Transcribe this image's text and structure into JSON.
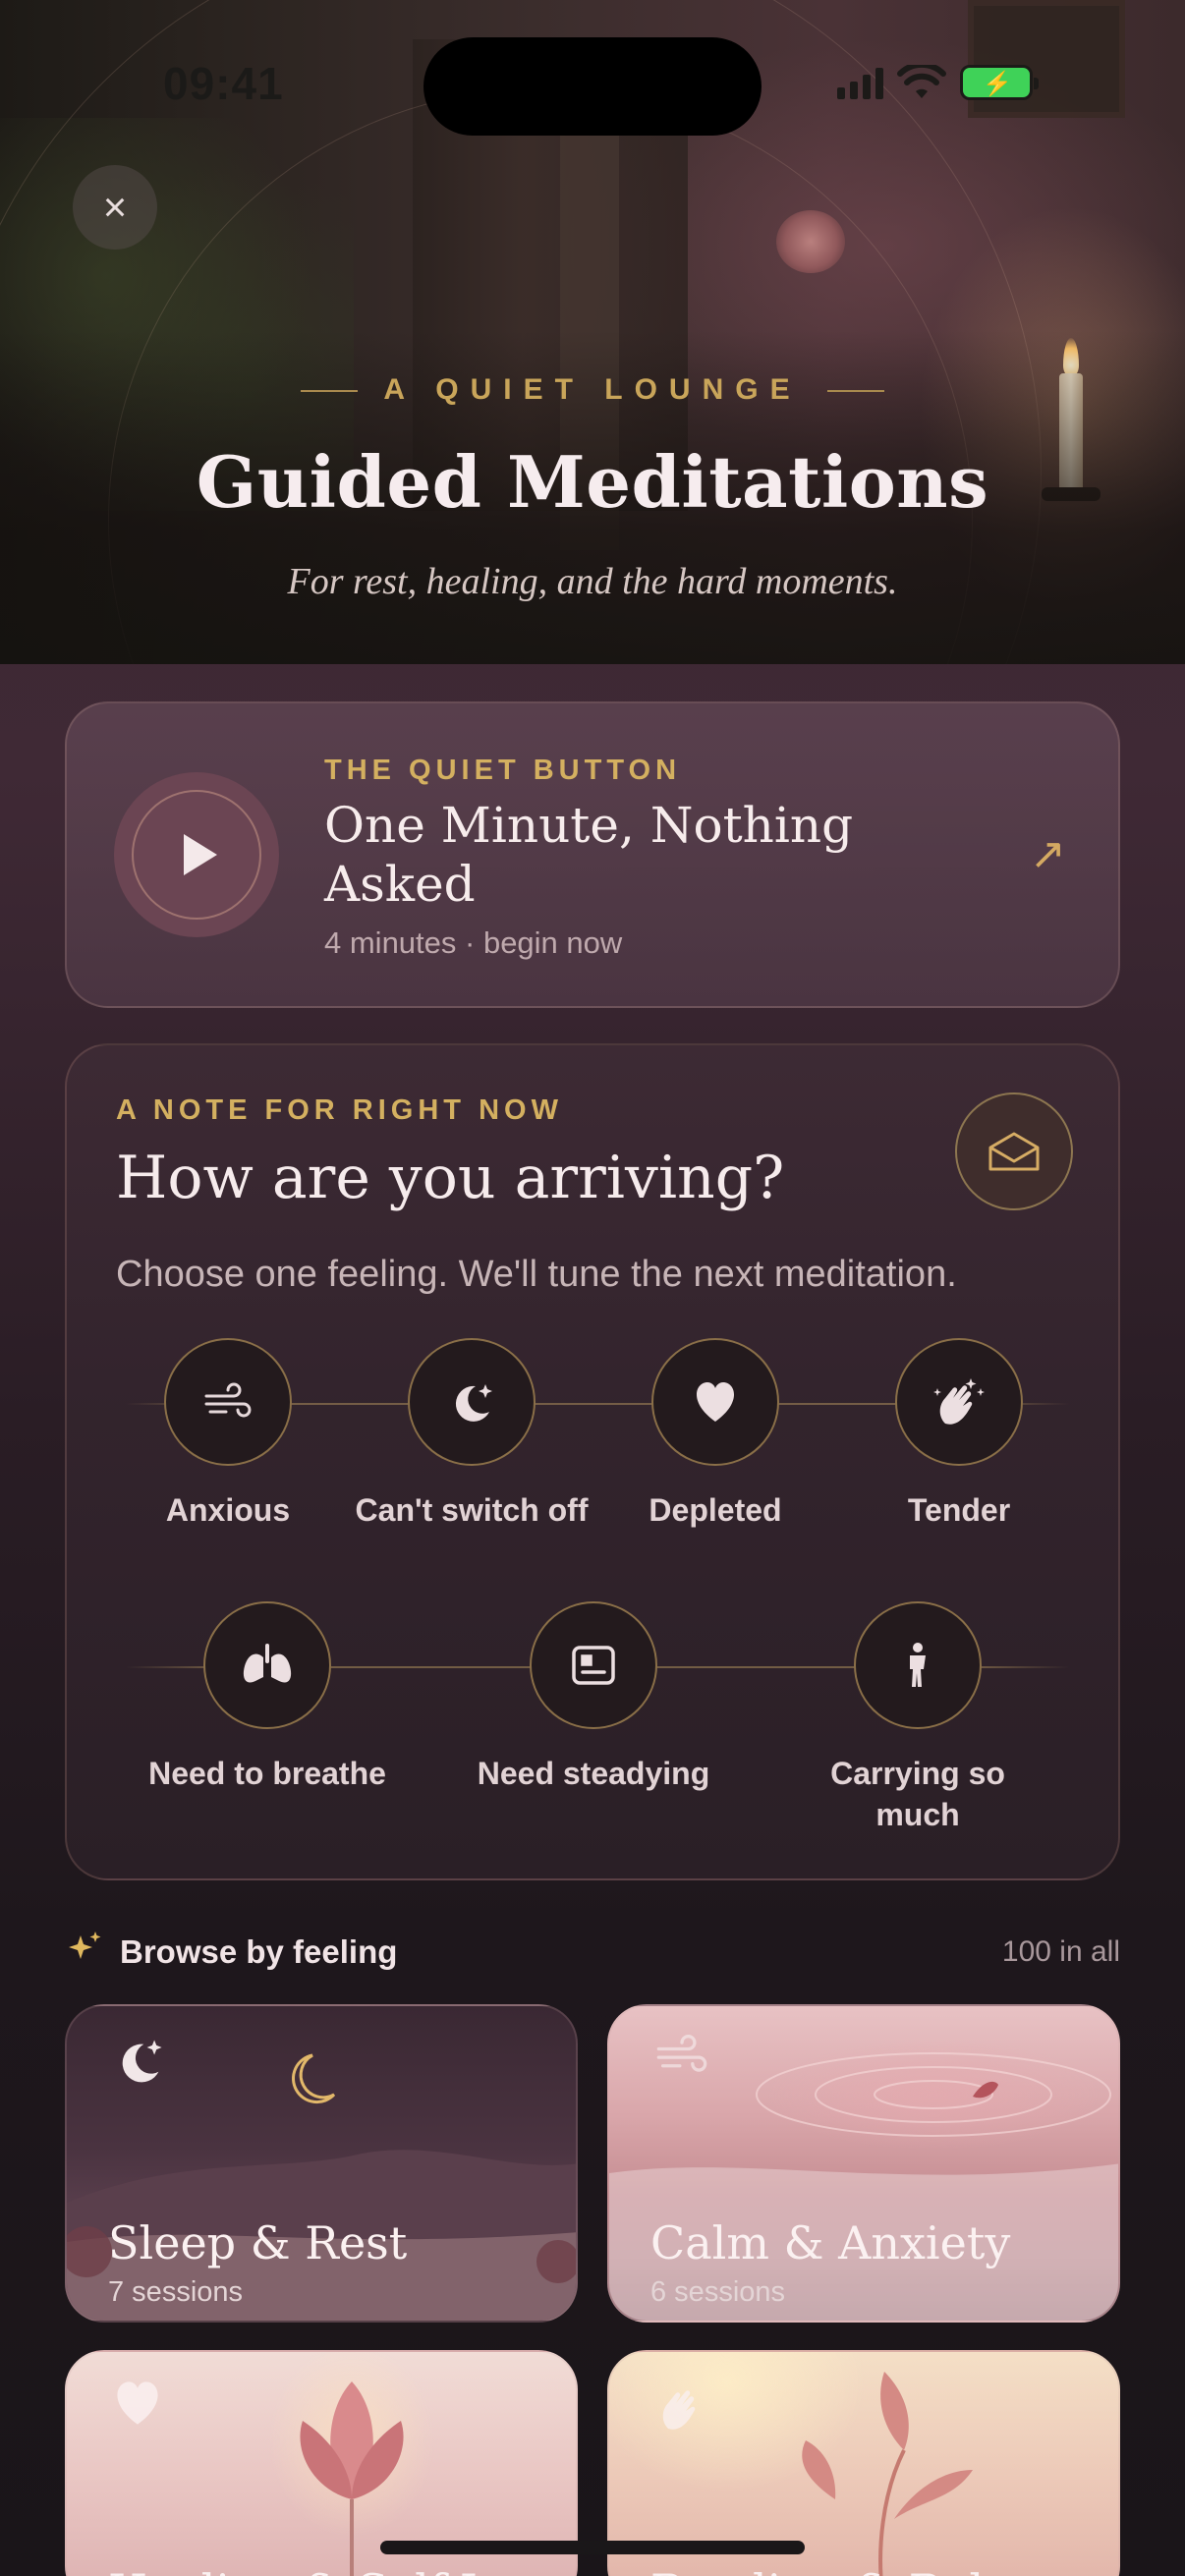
{
  "status_bar": {
    "time": "09:41"
  },
  "hero": {
    "kicker": "A QUIET LOUNGE",
    "title": "Guided Meditations",
    "subtitle": "For rest, healing, and the hard moments."
  },
  "quiet_button": {
    "kicker": "THE QUIET BUTTON",
    "title": "One Minute, Nothing Asked",
    "meta": "4 minutes · begin now"
  },
  "note": {
    "kicker": "A NOTE FOR RIGHT NOW",
    "title": "How are you arriving?",
    "subtitle": "Choose one feeling. We'll tune the next meditation.",
    "feelings": [
      {
        "label": "Anxious",
        "icon": "wind-icon"
      },
      {
        "label": "Can't switch off",
        "icon": "moon-stars-icon"
      },
      {
        "label": "Depleted",
        "icon": "heart-icon"
      },
      {
        "label": "Tender",
        "icon": "clapping-hands-icon"
      },
      {
        "label": "Need to breathe",
        "icon": "lungs-icon"
      },
      {
        "label": "Need steadying",
        "icon": "card-icon"
      },
      {
        "label": "Carrying so much",
        "icon": "person-icon"
      }
    ]
  },
  "browse": {
    "title": "Browse by feeling",
    "count": "100 in all",
    "tiles": [
      {
        "name": "Sleep & Rest",
        "count": "7 sessions",
        "icon": "moon-stars-icon"
      },
      {
        "name": "Calm & Anxiety",
        "count": "6 sessions",
        "icon": "wind-icon"
      },
      {
        "name": "Healing & Self-Love",
        "count": "",
        "icon": "heart-icon"
      },
      {
        "name": "Reading & Release",
        "count": "",
        "icon": "clapping-hands-icon"
      }
    ]
  },
  "colors": {
    "accent_gold": "#d4b060",
    "play_button": "#6b4553",
    "card_background": "#33242d"
  }
}
